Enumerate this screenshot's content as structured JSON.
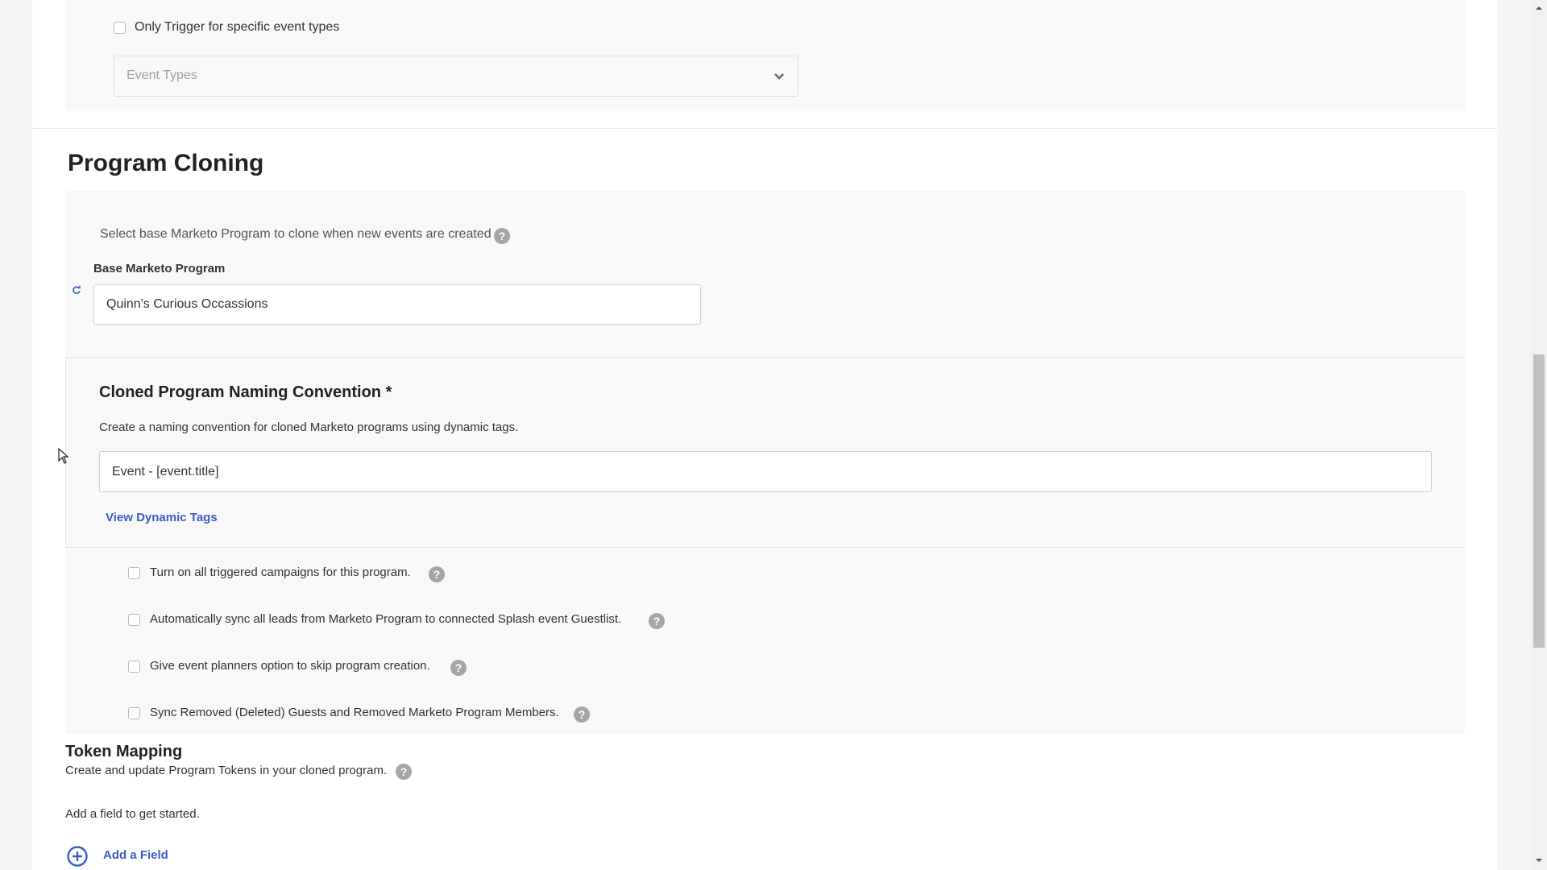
{
  "event_trigger": {
    "checkbox_label": "Only Trigger for specific event types",
    "event_types_placeholder": "Event Types"
  },
  "program_cloning": {
    "title": "Program Cloning",
    "description": "Select base Marketo Program to clone when new events are created",
    "base_program_label": "Base Marketo Program",
    "base_program_value": "Quinn's Curious Occassions"
  },
  "naming_convention": {
    "title": "Cloned Program Naming Convention *",
    "description": "Create a naming convention for cloned Marketo programs using dynamic tags.",
    "value": "Event - [event.title]",
    "view_tags_link": "View Dynamic Tags"
  },
  "options": [
    {
      "label": "Turn on all triggered campaigns for this program."
    },
    {
      "label": "Automatically sync all leads from Marketo Program to connected Splash event Guestlist."
    },
    {
      "label": "Give event planners option to skip program creation."
    },
    {
      "label": "Sync Removed (Deleted) Guests and Removed Marketo Program Members."
    }
  ],
  "token_mapping": {
    "title": "Token Mapping",
    "description": "Create and update Program Tokens in your cloned program.",
    "empty_text": "Add a field to get started.",
    "add_field_link": "Add a Field"
  },
  "help_glyph": "?",
  "icons": {
    "refresh": "refresh-icon",
    "chevron": "chevron-down-icon",
    "add": "plus-circle-icon"
  },
  "colors": {
    "link": "#3d5dc4",
    "panel": "#f8f8f9",
    "help": "#a6a6a6"
  }
}
